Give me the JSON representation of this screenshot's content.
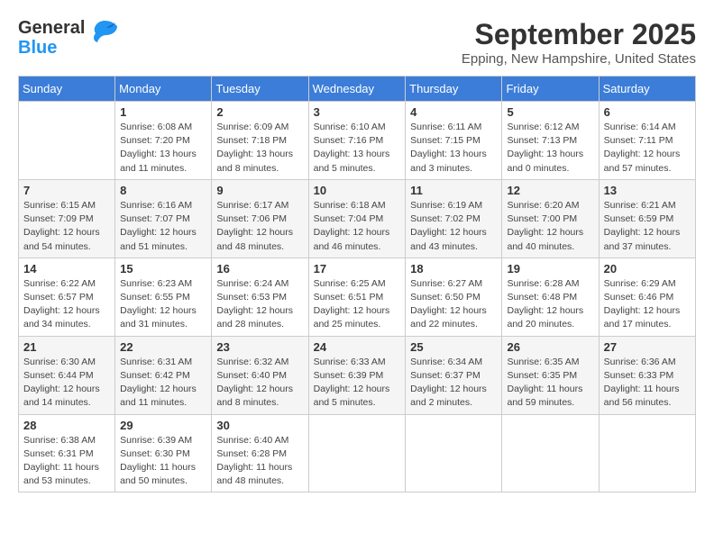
{
  "header": {
    "logo_general": "General",
    "logo_blue": "Blue",
    "month_title": "September 2025",
    "location": "Epping, New Hampshire, United States"
  },
  "calendar": {
    "days_of_week": [
      "Sunday",
      "Monday",
      "Tuesday",
      "Wednesday",
      "Thursday",
      "Friday",
      "Saturday"
    ],
    "weeks": [
      [
        {
          "num": "",
          "info": ""
        },
        {
          "num": "1",
          "info": "Sunrise: 6:08 AM\nSunset: 7:20 PM\nDaylight: 13 hours\nand 11 minutes."
        },
        {
          "num": "2",
          "info": "Sunrise: 6:09 AM\nSunset: 7:18 PM\nDaylight: 13 hours\nand 8 minutes."
        },
        {
          "num": "3",
          "info": "Sunrise: 6:10 AM\nSunset: 7:16 PM\nDaylight: 13 hours\nand 5 minutes."
        },
        {
          "num": "4",
          "info": "Sunrise: 6:11 AM\nSunset: 7:15 PM\nDaylight: 13 hours\nand 3 minutes."
        },
        {
          "num": "5",
          "info": "Sunrise: 6:12 AM\nSunset: 7:13 PM\nDaylight: 13 hours\nand 0 minutes."
        },
        {
          "num": "6",
          "info": "Sunrise: 6:14 AM\nSunset: 7:11 PM\nDaylight: 12 hours\nand 57 minutes."
        }
      ],
      [
        {
          "num": "7",
          "info": "Sunrise: 6:15 AM\nSunset: 7:09 PM\nDaylight: 12 hours\nand 54 minutes."
        },
        {
          "num": "8",
          "info": "Sunrise: 6:16 AM\nSunset: 7:07 PM\nDaylight: 12 hours\nand 51 minutes."
        },
        {
          "num": "9",
          "info": "Sunrise: 6:17 AM\nSunset: 7:06 PM\nDaylight: 12 hours\nand 48 minutes."
        },
        {
          "num": "10",
          "info": "Sunrise: 6:18 AM\nSunset: 7:04 PM\nDaylight: 12 hours\nand 46 minutes."
        },
        {
          "num": "11",
          "info": "Sunrise: 6:19 AM\nSunset: 7:02 PM\nDaylight: 12 hours\nand 43 minutes."
        },
        {
          "num": "12",
          "info": "Sunrise: 6:20 AM\nSunset: 7:00 PM\nDaylight: 12 hours\nand 40 minutes."
        },
        {
          "num": "13",
          "info": "Sunrise: 6:21 AM\nSunset: 6:59 PM\nDaylight: 12 hours\nand 37 minutes."
        }
      ],
      [
        {
          "num": "14",
          "info": "Sunrise: 6:22 AM\nSunset: 6:57 PM\nDaylight: 12 hours\nand 34 minutes."
        },
        {
          "num": "15",
          "info": "Sunrise: 6:23 AM\nSunset: 6:55 PM\nDaylight: 12 hours\nand 31 minutes."
        },
        {
          "num": "16",
          "info": "Sunrise: 6:24 AM\nSunset: 6:53 PM\nDaylight: 12 hours\nand 28 minutes."
        },
        {
          "num": "17",
          "info": "Sunrise: 6:25 AM\nSunset: 6:51 PM\nDaylight: 12 hours\nand 25 minutes."
        },
        {
          "num": "18",
          "info": "Sunrise: 6:27 AM\nSunset: 6:50 PM\nDaylight: 12 hours\nand 22 minutes."
        },
        {
          "num": "19",
          "info": "Sunrise: 6:28 AM\nSunset: 6:48 PM\nDaylight: 12 hours\nand 20 minutes."
        },
        {
          "num": "20",
          "info": "Sunrise: 6:29 AM\nSunset: 6:46 PM\nDaylight: 12 hours\nand 17 minutes."
        }
      ],
      [
        {
          "num": "21",
          "info": "Sunrise: 6:30 AM\nSunset: 6:44 PM\nDaylight: 12 hours\nand 14 minutes."
        },
        {
          "num": "22",
          "info": "Sunrise: 6:31 AM\nSunset: 6:42 PM\nDaylight: 12 hours\nand 11 minutes."
        },
        {
          "num": "23",
          "info": "Sunrise: 6:32 AM\nSunset: 6:40 PM\nDaylight: 12 hours\nand 8 minutes."
        },
        {
          "num": "24",
          "info": "Sunrise: 6:33 AM\nSunset: 6:39 PM\nDaylight: 12 hours\nand 5 minutes."
        },
        {
          "num": "25",
          "info": "Sunrise: 6:34 AM\nSunset: 6:37 PM\nDaylight: 12 hours\nand 2 minutes."
        },
        {
          "num": "26",
          "info": "Sunrise: 6:35 AM\nSunset: 6:35 PM\nDaylight: 11 hours\nand 59 minutes."
        },
        {
          "num": "27",
          "info": "Sunrise: 6:36 AM\nSunset: 6:33 PM\nDaylight: 11 hours\nand 56 minutes."
        }
      ],
      [
        {
          "num": "28",
          "info": "Sunrise: 6:38 AM\nSunset: 6:31 PM\nDaylight: 11 hours\nand 53 minutes."
        },
        {
          "num": "29",
          "info": "Sunrise: 6:39 AM\nSunset: 6:30 PM\nDaylight: 11 hours\nand 50 minutes."
        },
        {
          "num": "30",
          "info": "Sunrise: 6:40 AM\nSunset: 6:28 PM\nDaylight: 11 hours\nand 48 minutes."
        },
        {
          "num": "",
          "info": ""
        },
        {
          "num": "",
          "info": ""
        },
        {
          "num": "",
          "info": ""
        },
        {
          "num": "",
          "info": ""
        }
      ]
    ]
  }
}
